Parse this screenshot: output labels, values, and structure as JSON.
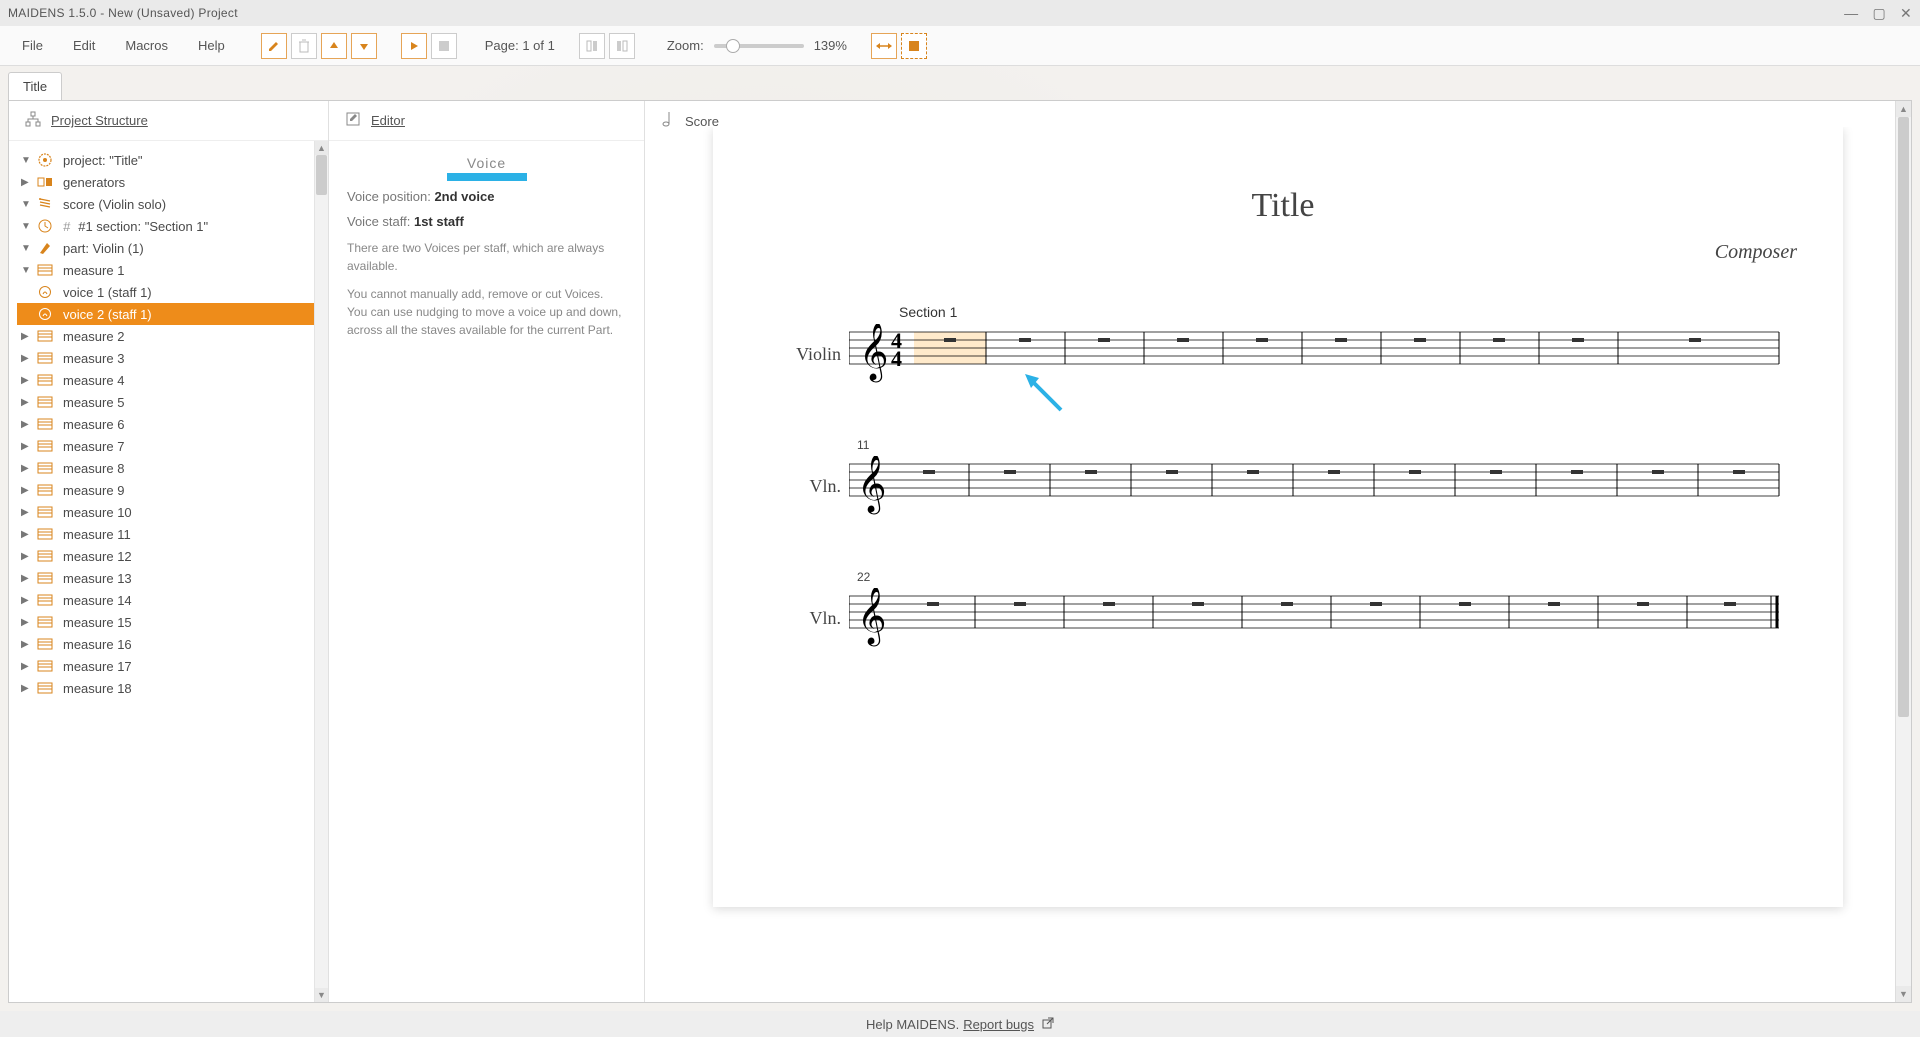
{
  "titlebar": "MAIDENS 1.5.0 - New (Unsaved) Project",
  "menu": {
    "file": "File",
    "edit": "Edit",
    "macros": "Macros",
    "help": "Help"
  },
  "pageinfo": "Page: 1 of 1",
  "zoom_label": "Zoom:",
  "zoom_pct": "139%",
  "tab": "Title",
  "panels": {
    "structure": "Project Structure",
    "editor": "Editor",
    "score": "Score"
  },
  "tree": {
    "project": "project: \"Title\"",
    "generators": "generators",
    "score": "score (Violin solo)",
    "section": "#1 section: \"Section 1\"",
    "section_hash": "#",
    "part": "part: Violin (1)",
    "measure1": "measure 1",
    "voice1": "voice 1 (staff 1)",
    "voice2": "voice 2 (staff 1)",
    "measures": [
      "measure 2",
      "measure 3",
      "measure 4",
      "measure 5",
      "measure 6",
      "measure 7",
      "measure 8",
      "measure 9",
      "measure 10",
      "measure 11",
      "measure 12",
      "measure 13",
      "measure 14",
      "measure 15",
      "measure 16",
      "measure 17",
      "measure 18"
    ]
  },
  "editor": {
    "title": "Voice",
    "pos_k": "Voice position: ",
    "pos_v": "2nd voice",
    "staff_k": "Voice staff: ",
    "staff_v": "1st staff",
    "d1": "There are two Voices per staff, which are always available.",
    "d2": "You cannot manually add, remove or cut Voices. You can use nudging to move a voice up and down, across all the staves available for the current Part."
  },
  "score": {
    "title": "Title",
    "composer": "Composer",
    "section": "Section 1",
    "violin": "Violin",
    "vln": "Vln.",
    "bar11": "11",
    "bar22": "22"
  },
  "footer": {
    "main": "Help MAIDENS. ",
    "link": "Report bugs"
  }
}
